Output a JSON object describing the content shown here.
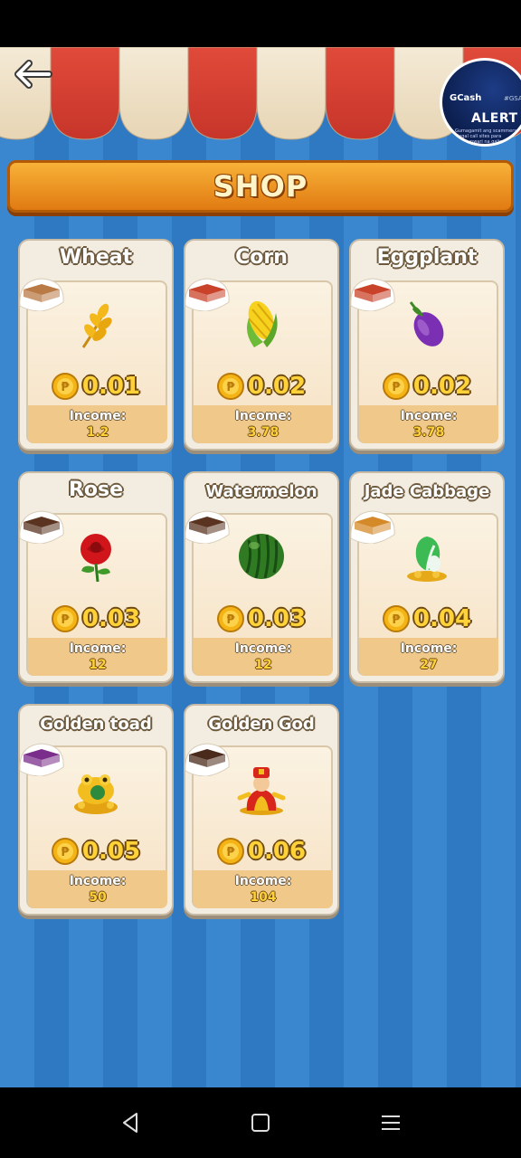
{
  "header": {
    "title": "SHOP",
    "ad": {
      "brand": "GCash",
      "alert": "ALERT",
      "tag": "#GSAFE",
      "fine_print": "Gumagamit ang scammers ng illegal call sites para magkunwari na galing sa GCash"
    }
  },
  "items": [
    {
      "name": "Wheat",
      "price": "0.01",
      "income_label": "Income:",
      "income": "1.2",
      "soil_color": "#b97a45",
      "icon": "wheat-icon"
    },
    {
      "name": "Corn",
      "price": "0.02",
      "income_label": "Income:",
      "income": "3.78",
      "soil_color": "#c9432a",
      "icon": "corn-icon"
    },
    {
      "name": "Eggplant",
      "price": "0.02",
      "income_label": "Income:",
      "income": "3.78",
      "soil_color": "#c9432a",
      "icon": "eggplant-icon"
    },
    {
      "name": "Rose",
      "price": "0.03",
      "income_label": "Income:",
      "income": "12",
      "soil_color": "#5a3420",
      "icon": "rose-icon"
    },
    {
      "name": "Watermelon",
      "price": "0.03",
      "income_label": "Income:",
      "income": "12",
      "soil_color": "#5a3420",
      "icon": "watermelon-icon"
    },
    {
      "name": "Jade Cabbage",
      "price": "0.04",
      "income_label": "Income:",
      "income": "27",
      "soil_color": "#d58a2a",
      "icon": "jade-cabbage-icon"
    },
    {
      "name": "Golden toad",
      "price": "0.05",
      "income_label": "Income:",
      "income": "50",
      "soil_color": "#7a2d8a",
      "icon": "golden-toad-icon"
    },
    {
      "name": "Golden God",
      "price": "0.06",
      "income_label": "Income:",
      "income": "104",
      "soil_color": "#4a2a1a",
      "icon": "golden-god-icon"
    }
  ],
  "colors": {
    "banner": "#f0961f",
    "background_stripe_a": "#3a86cf",
    "background_stripe_b": "#2f78c2",
    "coin": "#f5b416"
  }
}
